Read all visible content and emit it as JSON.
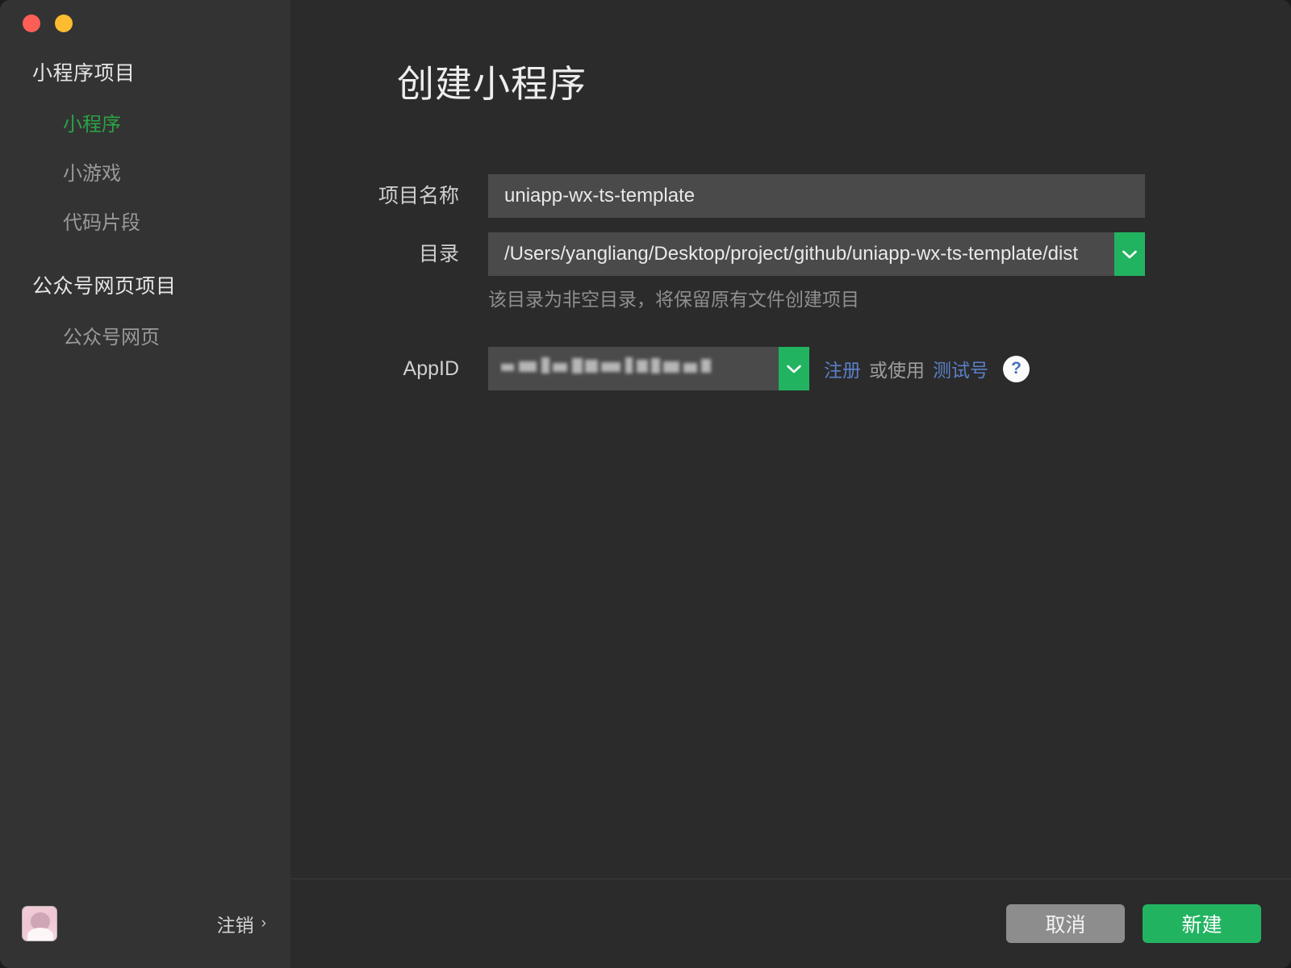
{
  "window": {
    "controls": [
      {
        "name": "close",
        "color": "#fd5f57"
      },
      {
        "name": "minimize",
        "color": "#fdbc2f"
      }
    ]
  },
  "sidebar": {
    "groups": [
      {
        "title": "小程序项目",
        "items": [
          {
            "label": "小程序",
            "active": true
          },
          {
            "label": "小游戏",
            "active": false
          },
          {
            "label": "代码片段",
            "active": false
          }
        ]
      },
      {
        "title": "公众号网页项目",
        "items": [
          {
            "label": "公众号网页",
            "active": false
          }
        ]
      }
    ],
    "footer": {
      "logout_label": "注销",
      "logout_chevron": "›"
    }
  },
  "main": {
    "title": "创建小程序",
    "form": {
      "project_name": {
        "label": "项目名称",
        "value": "uniapp-wx-ts-template"
      },
      "directory": {
        "label": "目录",
        "value": "/Users/yangliang/Desktop/project/github/uniapp-wx-ts-template/dist",
        "hint": "该目录为非空目录，将保留原有文件创建项目"
      },
      "appid": {
        "label": "AppID",
        "value": "",
        "register_link": "注册",
        "or_text": "或使用",
        "test_link": "测试号",
        "help_glyph": "?"
      }
    },
    "footer": {
      "cancel_label": "取消",
      "confirm_label": "新建"
    }
  },
  "colors": {
    "accent_green": "#22b361",
    "active_green": "#2ba245",
    "link_blue": "#5b7fc7",
    "sidebar_bg": "#333333",
    "main_bg": "#2b2b2b",
    "input_bg": "#4a4a4a"
  }
}
